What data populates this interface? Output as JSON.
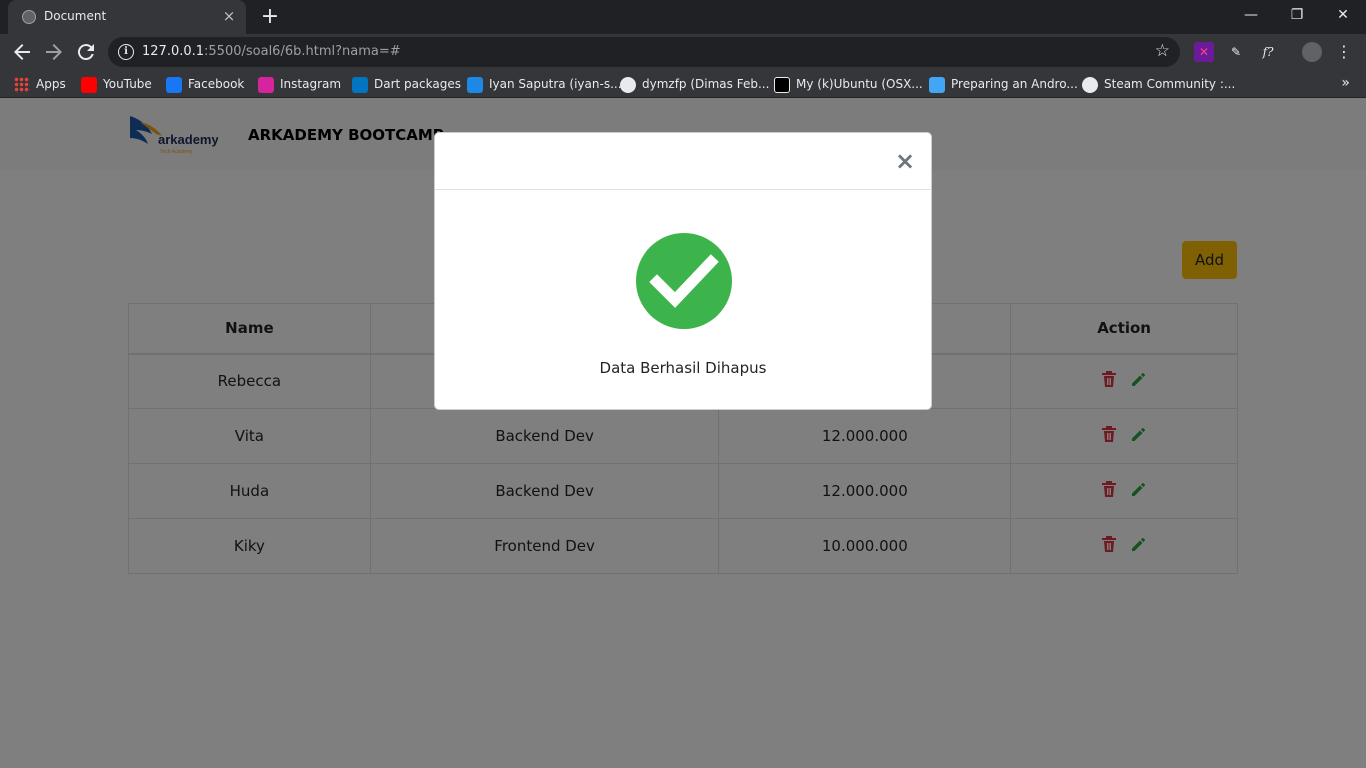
{
  "browser": {
    "tab_title": "Document",
    "tab_close": "×",
    "new_tab": "+",
    "url_host": "127.0.0.1",
    "url_path": ":5500/soal6/6b.html?nama=#",
    "window": {
      "minimize": "—",
      "restore": "❐",
      "close": "✕"
    },
    "bookmarks": [
      {
        "label": "Apps",
        "color": "#e8eaed"
      },
      {
        "label": "YouTube",
        "color": "#ff0000"
      },
      {
        "label": "Facebook",
        "color": "#1877f2"
      },
      {
        "label": "Instagram",
        "color": "#d6249f"
      },
      {
        "label": "Dart packages",
        "color": "#0175c2"
      },
      {
        "label": "Iyan Saputra (iyan-s...",
        "color": "#1e88e5"
      },
      {
        "label": "dymzfp (Dimas Feb...",
        "color": "#111111"
      },
      {
        "label": "My (k)Ubuntu (OSX...",
        "color": "#000000"
      },
      {
        "label": "Preparing an Andro...",
        "color": "#42a5f5"
      },
      {
        "label": "Steam Community :...",
        "color": "#1b2838"
      }
    ],
    "bookmarks_more": "»"
  },
  "navbar": {
    "logo_text": "arkademy",
    "logo_subtext": "Tech Academy",
    "brand": "ARKADEMY BOOTCAMP"
  },
  "main": {
    "add_label": "Add",
    "table": {
      "headers": [
        "Name",
        "",
        "",
        "Action"
      ],
      "rows": [
        {
          "name": "Rebecca",
          "position": "",
          "salary": ""
        },
        {
          "name": "Vita",
          "position": "Backend Dev",
          "salary": "12.000.000"
        },
        {
          "name": "Huda",
          "position": "Backend Dev",
          "salary": "12.000.000"
        },
        {
          "name": "Kiky",
          "position": "Frontend Dev",
          "salary": "10.000.000"
        }
      ]
    },
    "colors": {
      "delete": "#dc3545",
      "edit": "#28a745",
      "add": "#ffc107"
    }
  },
  "modal": {
    "close_label": "×",
    "message": "Data Berhasil Dihapus",
    "icon": "check-circle-icon",
    "icon_color": "#3cb44b"
  }
}
